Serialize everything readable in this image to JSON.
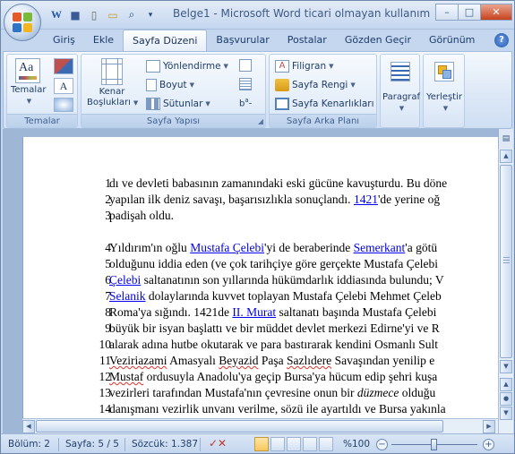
{
  "window": {
    "title": "Belge1 - Microsoft Word ticari olmayan kullanım",
    "controls": {
      "minimize": "–",
      "maximize": "□",
      "close": "✕"
    }
  },
  "quick_access": [
    {
      "icon": "word-doc-icon",
      "glyph": "W"
    },
    {
      "icon": "save-icon",
      "glyph": "■"
    },
    {
      "icon": "new-doc-icon",
      "glyph": "▯"
    },
    {
      "icon": "open-folder-icon",
      "glyph": "▭"
    },
    {
      "icon": "print-preview-icon",
      "glyph": "⌕"
    },
    {
      "icon": "customize-qat-icon",
      "glyph": "▾"
    }
  ],
  "tabs": [
    {
      "label": "Giriş",
      "active": false
    },
    {
      "label": "Ekle",
      "active": false
    },
    {
      "label": "Sayfa Düzeni",
      "active": true
    },
    {
      "label": "Başvurular",
      "active": false
    },
    {
      "label": "Postalar",
      "active": false
    },
    {
      "label": "Gözden Geçir",
      "active": false
    },
    {
      "label": "Görünüm",
      "active": false
    }
  ],
  "ribbon": {
    "temalar": {
      "button": "Temalar",
      "group": "Temalar"
    },
    "sayfa_yapisi": {
      "kenar": "Kenar",
      "bosluklari": "Boşlukları",
      "yonlendirme": "Yönlendirme",
      "boyut": "Boyut",
      "sutunlar": "Sütunlar",
      "group": "Sayfa Yapısı"
    },
    "arka_plan": {
      "filigran": "Filigran",
      "renk": "Sayfa Rengi",
      "kenarlik": "Sayfa Kenarlıkları",
      "group": "Sayfa Arka Planı"
    },
    "paragraf": "Paragraf",
    "yerlestir": "Yerleştir"
  },
  "document": {
    "lines": [
      {
        "num": "1",
        "segments": [
          {
            "t": "dı ve devleti babasının zamanındaki eski gücüne kavuşturdu. Bu döne"
          }
        ]
      },
      {
        "num": "2",
        "segments": [
          {
            "t": "yapılan ilk deniz savaşı, başarısızlıkla  sonuçlandı. "
          },
          {
            "t": "1421",
            "link": true
          },
          {
            "t": "'de yerine oğ"
          }
        ]
      },
      {
        "num": "3",
        "segments": [
          {
            "t": "padişah oldu."
          }
        ]
      },
      {
        "num": "4",
        "segments": [
          {
            "t": "Yıldırım'ın oğlu "
          },
          {
            "t": "Mustafa Çelebi",
            "link": true
          },
          {
            "t": "'yi  de beraberinde "
          },
          {
            "t": "Semerkant",
            "link": true
          },
          {
            "t": "'a götü"
          }
        ]
      },
      {
        "num": "5",
        "segments": [
          {
            "t": "olduğunu iddia eden (ve çok tarihçiye göre gerçekte Mustafa Çelebi"
          }
        ]
      },
      {
        "num": "6",
        "segments": [
          {
            "t": "Çelebi",
            "link": true
          },
          {
            "t": " saltanatının son yıllarında hükümdarlık iddiasında bulundu; V"
          }
        ]
      },
      {
        "num": "7",
        "segments": [
          {
            "t": "Selanik",
            "link": true
          },
          {
            "t": " dolaylarında kuvvet toplayan Mustafa Çelebi Mehmet Çeleb"
          }
        ]
      },
      {
        "num": "8",
        "segments": [
          {
            "t": "Roma'ya sığındı. 1421de "
          },
          {
            "t": "II. Murat",
            "link": true
          },
          {
            "t": " saltanatı başında Mustafa Çelebi "
          }
        ]
      },
      {
        "num": "9",
        "segments": [
          {
            "t": "büyük bir isyan başlattı ve bir müddet devlet merkezi Edirne'yi ve R"
          }
        ]
      },
      {
        "num": "10",
        "segments": [
          {
            "t": "alarak adına hutbe okutarak ve para bastırarak kendini Osmanlı Sult"
          }
        ]
      },
      {
        "num": "11",
        "segments": [
          {
            "t": "Veziriazami",
            "squig": true
          },
          {
            "t": " Amasyalı "
          },
          {
            "t": "Beyazid",
            "squig": true
          },
          {
            "t": " Paşa "
          },
          {
            "t": "Sazlıdere",
            "squig": true
          },
          {
            "t": " Savaşından yenilip e"
          }
        ]
      },
      {
        "num": "12",
        "segments": [
          {
            "t": "Mustaf",
            "squig": true
          },
          {
            "t": " ordusuyla Anadolu'ya geçip Bursa'ya hücum edip şehri kuşa"
          }
        ]
      },
      {
        "num": "13",
        "segments": [
          {
            "t": "vezirleri tarafından Mustafa'nın çevresine onun bir "
          },
          {
            "t": "düzmece",
            "italic": true
          },
          {
            "t": " olduğu"
          }
        ]
      },
      {
        "num": "14",
        "segments": [
          {
            "t": "danışmanı vezirlik unvanı verilme, sözü ile ayartıldı ve Bursa yakınla"
          }
        ]
      }
    ]
  },
  "status": {
    "bolum": "Bölüm: 2",
    "sayfa": "Sayfa: 5 / 5",
    "sozcuk": "Sözcük: 1.387",
    "zoom": "%100",
    "zoom_level_percent": 100
  },
  "colors": {
    "link": "#0000ee",
    "accent": "#c4d6ee",
    "close_button": "#c7421c"
  }
}
